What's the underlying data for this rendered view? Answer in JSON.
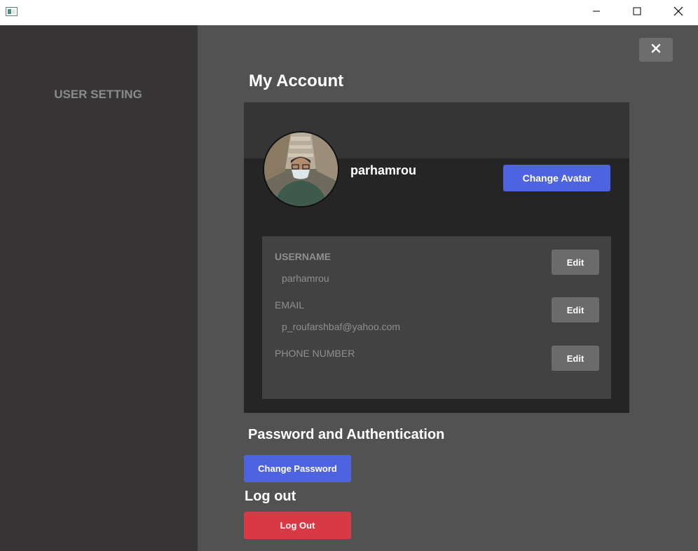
{
  "window": {
    "minimize_icon": "minimize-icon",
    "maximize_icon": "maximize-icon",
    "close_icon": "close-icon"
  },
  "sidebar": {
    "title": "USER SETTING"
  },
  "main": {
    "title": "My Account",
    "close_icon": "close-icon",
    "profile": {
      "username": "parhamrou",
      "change_avatar_label": "Change Avatar",
      "avatar_alt": "user avatar photo"
    },
    "fields": [
      {
        "label": "USERNAME",
        "value": "parhamrou",
        "edit_label": "Edit"
      },
      {
        "label": "EMAIL",
        "value": "p_roufarshbaf@yahoo.com",
        "edit_label": "Edit"
      },
      {
        "label": "PHONE NUMBER",
        "value": "",
        "edit_label": "Edit"
      }
    ],
    "password_section": {
      "title": "Password and Authentication",
      "button_label": "Change Password"
    },
    "logout_section": {
      "title": "Log out",
      "button_label": "Log Out"
    }
  },
  "colors": {
    "accent": "#4e63e0",
    "danger": "#d83a45",
    "sidebar_bg": "#373536",
    "main_bg": "#525252",
    "card_bg": "#252525",
    "panel_bg": "#424242"
  }
}
